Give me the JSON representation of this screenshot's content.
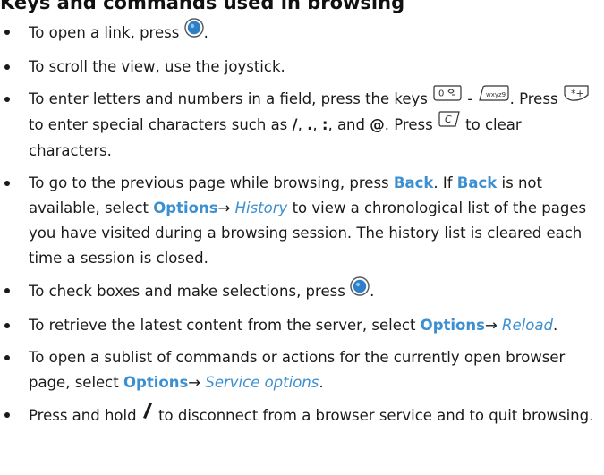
{
  "heading": "Keys and commands used in browsing",
  "b1": {
    "pre": "To open a link, press",
    "post": "."
  },
  "b2": {
    "text": "To scroll the view, use the joystick."
  },
  "b3": {
    "pre": "To enter letters and numbers in a field, press the keys",
    "dash": "-",
    "post1": ".",
    "press": "Press",
    "mid": "to enter special characters such as",
    "s1": "/",
    "sep1": ",",
    "s2": ".",
    "sep2": ",",
    "s3": ":",
    "sep3": ", and",
    "s4": "@",
    "post2": ". Press",
    "end": "to clear characters."
  },
  "b4": {
    "pre": "To go to the previous page while browsing, press",
    "back1": "Back",
    "mid1": ". If",
    "back2": "Back",
    "mid2": "is not available, select",
    "options": "Options",
    "arrow": "→",
    "history": "History",
    "post": "to view a chronological list of the pages you have visited during a browsing session. The history list is cleared each time a session is closed."
  },
  "b5": {
    "pre": "To check boxes and make selections, press",
    "post": "."
  },
  "b6": {
    "pre": "To retrieve the latest content from the server, select",
    "options": "Options",
    "arrow": "→",
    "reload": "Reload",
    "post": "."
  },
  "b7": {
    "pre": "To open a sublist of commands or actions for the currently open browser page, select",
    "options": "Options",
    "arrow": "→",
    "service": "Service options",
    "post": "."
  },
  "b8": {
    "pre": "Press and hold",
    "post": "to disconnect from a browser service and to quit browsing."
  },
  "keys": {
    "zero": "0",
    "nine": "wxyz9",
    "star": "*+",
    "clear": "C"
  }
}
